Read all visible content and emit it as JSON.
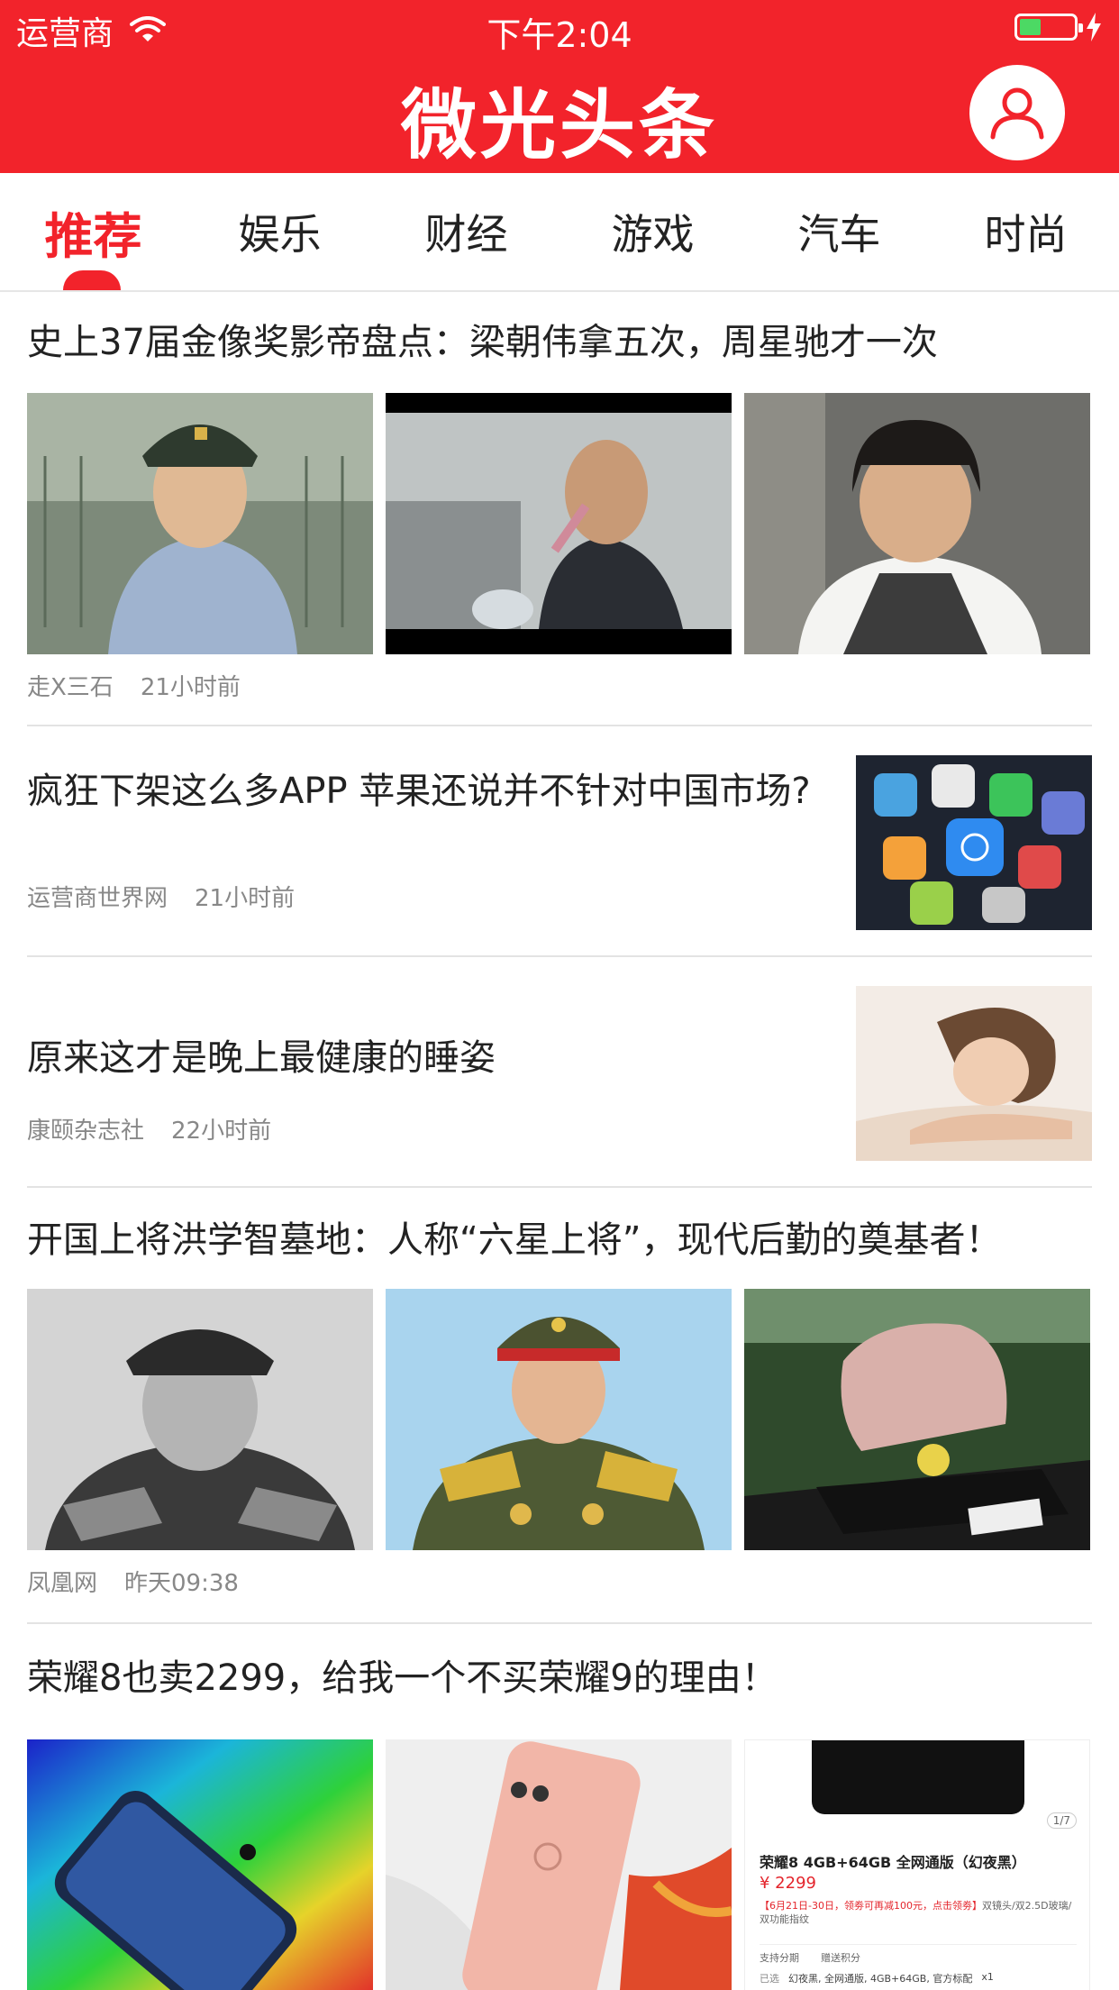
{
  "status": {
    "carrier": "运营商",
    "time": "下午2:04"
  },
  "header": {
    "title": "微光头条",
    "brand_color": "#f2232b"
  },
  "tabs": [
    {
      "label": "推荐",
      "active": true
    },
    {
      "label": "娱乐",
      "active": false
    },
    {
      "label": "财经",
      "active": false
    },
    {
      "label": "游戏",
      "active": false
    },
    {
      "label": "汽车",
      "active": false
    },
    {
      "label": "时尚",
      "active": false
    }
  ],
  "articles": [
    {
      "title": "史上37届金像奖影帝盘点：梁朝伟拿五次，周星驰才一次",
      "source": "走X三石",
      "time": "21小时前",
      "layout": "three-images"
    },
    {
      "title": "疯狂下架这么多APP 苹果还说并不针对中国市场?",
      "source": "运营商世界网",
      "time": "21小时前",
      "layout": "right-image"
    },
    {
      "title": "原来这才是晚上最健康的睡姿",
      "source": "康颐杂志社",
      "time": "22小时前",
      "layout": "right-image"
    },
    {
      "title": "开国上将洪学智墓地：人称“六星上将”，现代后勤的奠基者！",
      "source": "凤凰网",
      "time": "昨天09:38",
      "layout": "three-images"
    },
    {
      "title": "荣耀8也卖2299，给我一个不买荣耀9的理由！",
      "source": "",
      "time": "",
      "layout": "three-images"
    }
  ],
  "product_card": {
    "page": "1/7",
    "name": "荣耀8 4GB+64GB 全网通版（幻夜黑）",
    "price": "¥ 2299",
    "promo": "【6月21日-30日，领劵可再减100元，点击领劵】",
    "promo_tail": "双镜头/双2.5D玻璃/双功能指纹",
    "option1": "支持分期",
    "option2": "赠送积分",
    "selected_label": "已选",
    "selected": "幻夜黑, 全网通版, 4GB+64GB, 官方标配",
    "qty": "x1"
  }
}
